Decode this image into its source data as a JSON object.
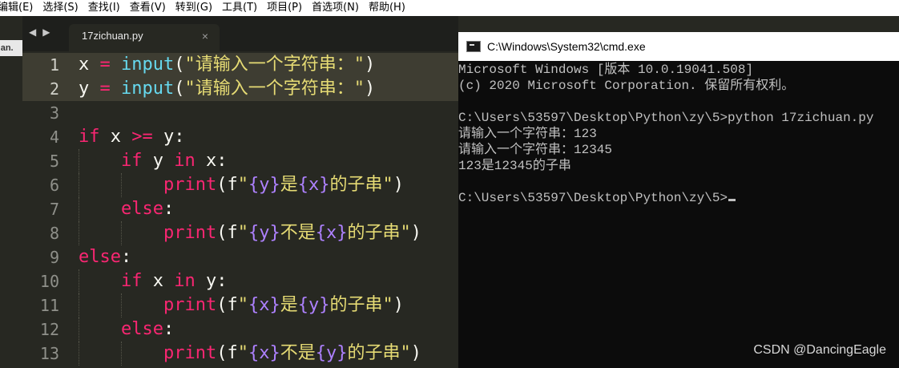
{
  "menubar": {
    "items": [
      "编辑(E)",
      "选择(S)",
      "查找(I)",
      "查看(V)",
      "转到(G)",
      "工具(T)",
      "项目(P)",
      "首选项(N)",
      "帮助(H)"
    ]
  },
  "sidebar": {
    "tab_label": "uan."
  },
  "tabbar": {
    "back": "◀",
    "forward": "▶",
    "tab_label": "17zichuan.py",
    "close": "×"
  },
  "editor": {
    "line_numbers": [
      "1",
      "2",
      "3",
      "4",
      "5",
      "6",
      "7",
      "8",
      "9",
      "10",
      "11",
      "12",
      "13"
    ],
    "active_lines": [
      1,
      2
    ],
    "lines": [
      {
        "indent": 0,
        "tokens": [
          [
            "pn",
            "x "
          ],
          [
            "kw",
            "="
          ],
          [
            "pn",
            " "
          ],
          [
            "fn",
            "input"
          ],
          [
            "pn",
            "("
          ],
          [
            "str",
            "\"请输入一个字符串：\""
          ],
          [
            "pn",
            ")"
          ]
        ]
      },
      {
        "indent": 0,
        "tokens": [
          [
            "pn",
            "y "
          ],
          [
            "kw",
            "="
          ],
          [
            "pn",
            " "
          ],
          [
            "fn",
            "input"
          ],
          [
            "pn",
            "("
          ],
          [
            "str",
            "\"请输入一个字符串：\""
          ],
          [
            "pn",
            ")"
          ]
        ]
      },
      {
        "indent": 0,
        "tokens": []
      },
      {
        "indent": 0,
        "tokens": [
          [
            "kw",
            "if"
          ],
          [
            "pn",
            " x "
          ],
          [
            "kw",
            ">="
          ],
          [
            "pn",
            " y:"
          ]
        ]
      },
      {
        "indent": 1,
        "tokens": [
          [
            "kw",
            "if"
          ],
          [
            "pn",
            " y "
          ],
          [
            "kw",
            "in"
          ],
          [
            "pn",
            " x:"
          ]
        ]
      },
      {
        "indent": 2,
        "tokens": [
          [
            "kw",
            "print"
          ],
          [
            "pn",
            "(f"
          ],
          [
            "str",
            "\""
          ],
          [
            "fv",
            "{y}"
          ],
          [
            "str",
            "是"
          ],
          [
            "fv",
            "{x}"
          ],
          [
            "str",
            "的子串\""
          ],
          [
            "pn",
            ")"
          ]
        ]
      },
      {
        "indent": 1,
        "tokens": [
          [
            "kw",
            "else"
          ],
          [
            "pn",
            ":"
          ]
        ]
      },
      {
        "indent": 2,
        "tokens": [
          [
            "kw",
            "print"
          ],
          [
            "pn",
            "(f"
          ],
          [
            "str",
            "\""
          ],
          [
            "fv",
            "{y}"
          ],
          [
            "str",
            "不是"
          ],
          [
            "fv",
            "{x}"
          ],
          [
            "str",
            "的子串\""
          ],
          [
            "pn",
            ")"
          ]
        ]
      },
      {
        "indent": 0,
        "tokens": [
          [
            "kw",
            "else"
          ],
          [
            "pn",
            ":"
          ]
        ]
      },
      {
        "indent": 1,
        "tokens": [
          [
            "kw",
            "if"
          ],
          [
            "pn",
            " x "
          ],
          [
            "kw",
            "in"
          ],
          [
            "pn",
            " y:"
          ]
        ]
      },
      {
        "indent": 2,
        "tokens": [
          [
            "kw",
            "print"
          ],
          [
            "pn",
            "(f"
          ],
          [
            "str",
            "\""
          ],
          [
            "fv",
            "{x}"
          ],
          [
            "str",
            "是"
          ],
          [
            "fv",
            "{y}"
          ],
          [
            "str",
            "的子串\""
          ],
          [
            "pn",
            ")"
          ]
        ]
      },
      {
        "indent": 1,
        "tokens": [
          [
            "kw",
            "else"
          ],
          [
            "pn",
            ":"
          ]
        ]
      },
      {
        "indent": 2,
        "tokens": [
          [
            "kw",
            "print"
          ],
          [
            "pn",
            "(f"
          ],
          [
            "str",
            "\""
          ],
          [
            "fv",
            "{x}"
          ],
          [
            "str",
            "不是"
          ],
          [
            "fv",
            "{y}"
          ],
          [
            "str",
            "的子串\""
          ],
          [
            "pn",
            ")"
          ]
        ]
      }
    ]
  },
  "cmd": {
    "title": "C:\\Windows\\System32\\cmd.exe",
    "lines": [
      "Microsoft Windows [版本 10.0.19041.508]",
      "(c) 2020 Microsoft Corporation. 保留所有权利。",
      "",
      "C:\\Users\\53597\\Desktop\\Python\\zy\\5>python 17zichuan.py",
      "请输入一个字符串：123",
      "请输入一个字符串：12345",
      "123是12345的子串",
      "",
      "C:\\Users\\53597\\Desktop\\Python\\zy\\5>"
    ]
  },
  "watermark": "CSDN @DancingEagle",
  "colors": {
    "editor_bg": "#272822",
    "keyword": "#f92672",
    "function": "#66d9ef",
    "string": "#e6db74",
    "fstring_var": "#ae81ff",
    "cmd_bg": "#0c0c0c",
    "cmd_text": "#c0c0c0"
  }
}
